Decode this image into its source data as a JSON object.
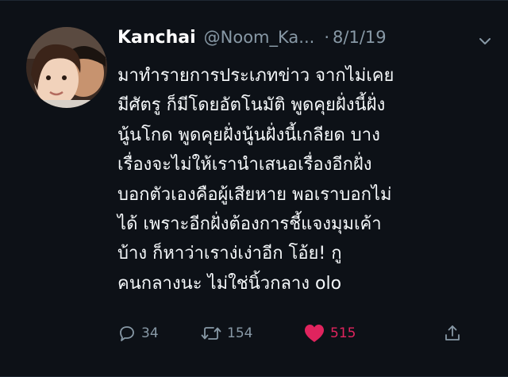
{
  "tweet": {
    "author_name": "Kanchai",
    "handle": "@Noom_Ka...",
    "separator": "·",
    "date": "8/1/19",
    "text_lines": [
      "มาทำรายการประเภทข่าว จากไม่เคย",
      "มีศัตรู ก็มีโดยอัตโนมัติ พูดคุยฝั่งนี้ฝั่ง",
      "นู้นโกด พูดคุยฝั่งนู้นฝั่งนี้เกลียด บาง",
      "เรื่องจะไม่ให้เรานำเสนอเรื่องอีกฝั่ง",
      "บอกตัวเองคือผู้เสียหาย พอเราบอกไม่",
      "ได้ เพราะอีกฝั่งต้องการชี้แจงมุมเค้า",
      "บ้าง ก็หาว่าเราง่เง่าอีก โอ้ย! กู",
      "คนกลางนะ ไม่ใช่นิ้วกลาง olo"
    ],
    "actions": {
      "reply_count": "34",
      "retweet_count": "154",
      "like_count": "515"
    },
    "icons": {
      "reply": "reply-icon",
      "retweet": "retweet-icon",
      "like": "heart-icon",
      "share": "share-icon",
      "menu": "chevron-down-icon"
    },
    "colors": {
      "background": "#0d1117",
      "text": "#f5f8fa",
      "muted": "#8899a6",
      "like": "#e0245e"
    }
  }
}
